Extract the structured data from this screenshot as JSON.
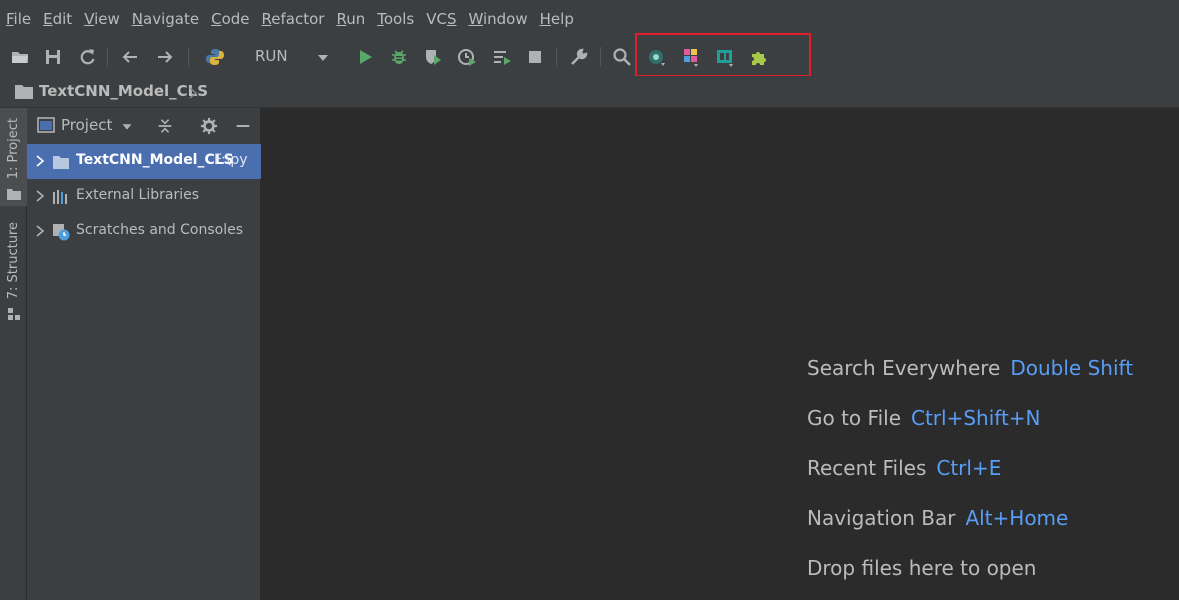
{
  "menu": [
    {
      "pre": "",
      "mn": "F",
      "post": "ile"
    },
    {
      "pre": "",
      "mn": "E",
      "post": "dit"
    },
    {
      "pre": "",
      "mn": "V",
      "post": "iew"
    },
    {
      "pre": "",
      "mn": "N",
      "post": "avigate"
    },
    {
      "pre": "",
      "mn": "C",
      "post": "ode"
    },
    {
      "pre": "",
      "mn": "R",
      "post": "efactor"
    },
    {
      "pre": "",
      "mn": "R",
      "post": "un"
    },
    {
      "pre": "",
      "mn": "T",
      "post": "ools"
    },
    {
      "pre": "VC",
      "mn": "S",
      "post": ""
    },
    {
      "pre": "",
      "mn": "W",
      "post": "indow"
    },
    {
      "pre": "",
      "mn": "H",
      "post": "elp"
    }
  ],
  "toolbar": {
    "run_config_label": "RUN",
    "icons": [
      "open-folder-icon",
      "save-icon",
      "sync-icon",
      "back-arrow-icon",
      "forward-arrow-icon",
      "python-icon",
      "run-icon",
      "debug-icon",
      "coverage-icon",
      "profile-icon",
      "concurrency-icon",
      "stop-icon",
      "wrench-icon",
      "search-icon",
      "plugin-a-icon",
      "plugin-b-icon",
      "plugin-c-icon",
      "plugin-puzzle-icon"
    ],
    "highlight_color": "#e01e2a"
  },
  "navbar": {
    "breadcrumb": "TextCNN_Model_CLS"
  },
  "left_stripe": {
    "project_tab": "1: Project",
    "structure_tab": "7: Structure"
  },
  "project_panel": {
    "title": "Project",
    "tree": [
      {
        "label": "TextCNN_Model_CLS",
        "path": "F:\\py",
        "selected": true
      },
      {
        "label": "External Libraries",
        "path": "",
        "selected": false
      },
      {
        "label": "Scratches and Consoles",
        "path": "",
        "selected": false
      }
    ]
  },
  "editor_hints": [
    {
      "text": "Search Everywhere",
      "shortcut": "Double Shift"
    },
    {
      "text": "Go to File",
      "shortcut": "Ctrl+Shift+N"
    },
    {
      "text": "Recent Files",
      "shortcut": "Ctrl+E"
    },
    {
      "text": "Navigation Bar",
      "shortcut": "Alt+Home"
    },
    {
      "text": "Drop files here to open",
      "shortcut": ""
    }
  ],
  "colors": {
    "accent_blue": "#589df6",
    "selection": "#4b6eaf",
    "run_green": "#59a869"
  }
}
